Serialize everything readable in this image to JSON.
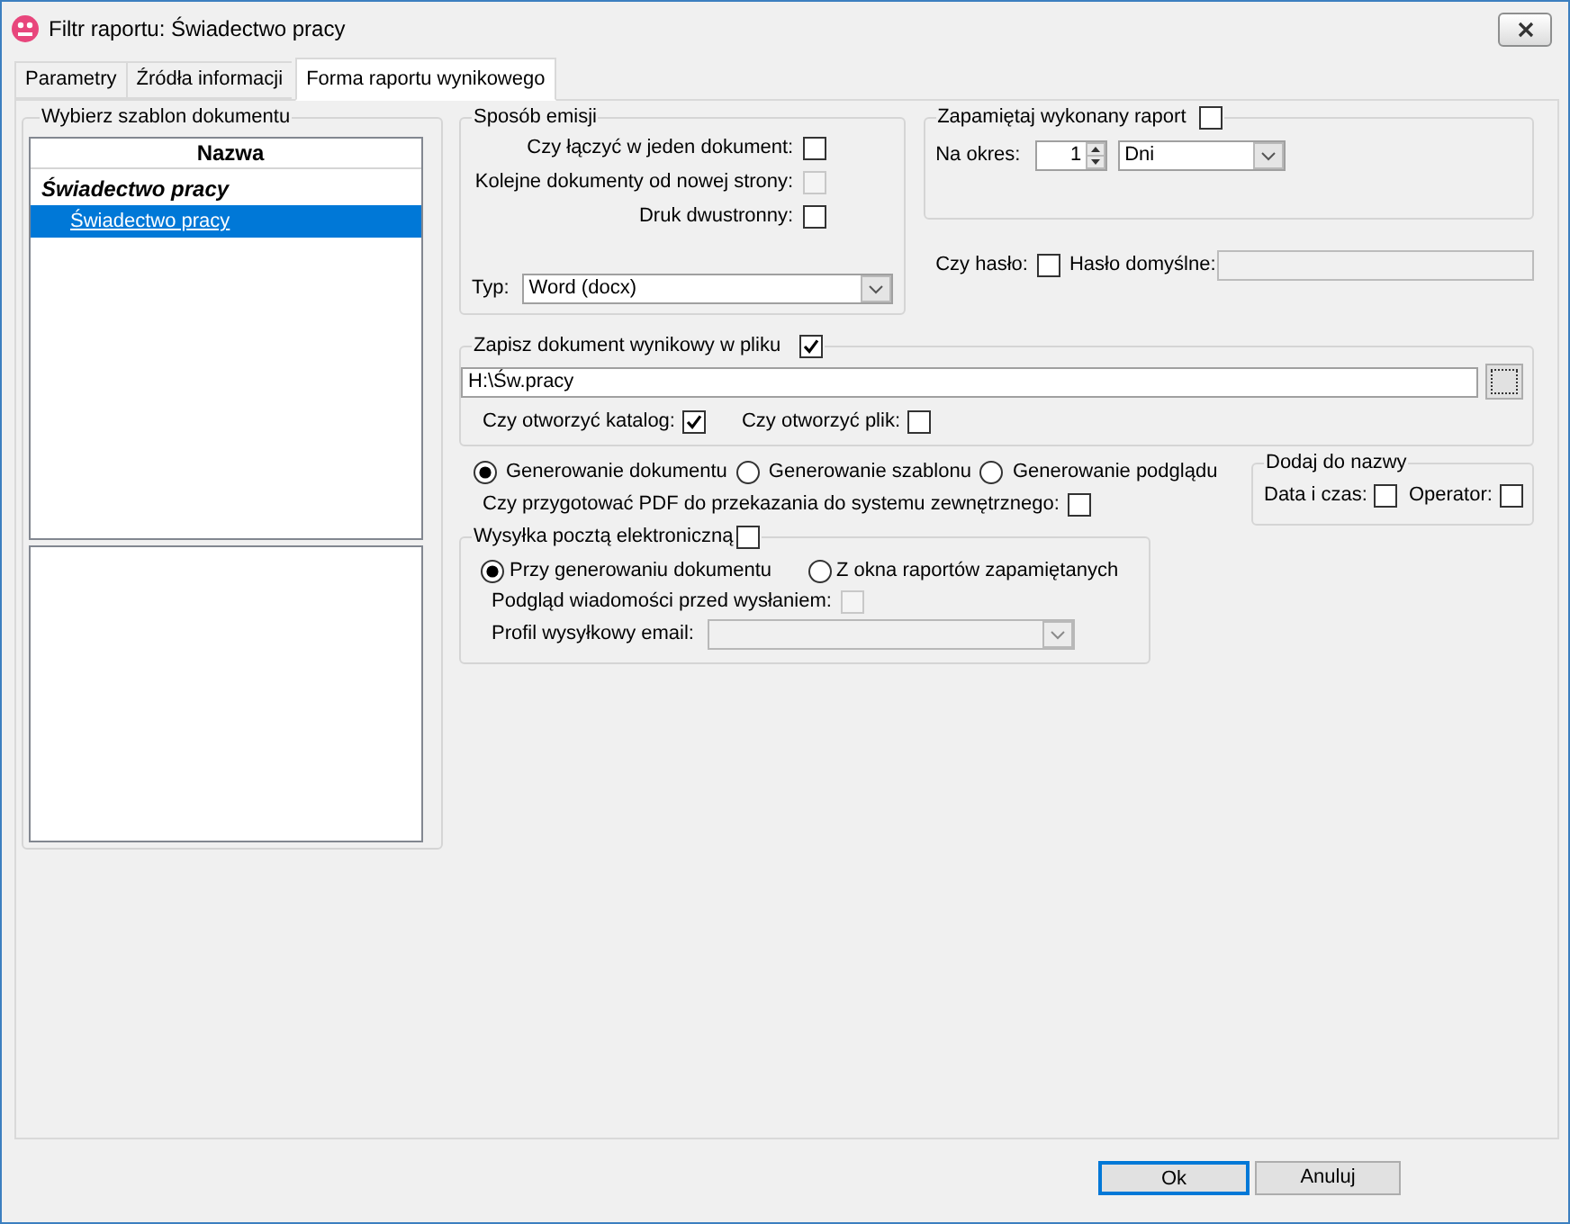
{
  "window": {
    "title": "Filtr raportu: Świadectwo pracy"
  },
  "tabs": [
    {
      "label": "Parametry",
      "selected": false
    },
    {
      "label": "Źródła informacji",
      "selected": false
    },
    {
      "label": "Forma raportu wynikowego",
      "selected": true
    }
  ],
  "template_list": {
    "title": "Wybierz szablon dokumentu",
    "column": "Nazwa",
    "items": [
      {
        "label": "Świadectwo pracy",
        "selected": false,
        "children": [
          {
            "label": "Świadectwo pracy",
            "selected": true
          }
        ]
      }
    ]
  },
  "emission": {
    "title": "Sposób emisji",
    "options": [
      {
        "label": "Czy łączyć w jeden dokument:",
        "checked": false,
        "disabled": false
      },
      {
        "label": "Kolejne dokumenty od nowej strony:",
        "checked": false,
        "disabled": true
      },
      {
        "label": "Druk dwustronny:",
        "checked": false,
        "disabled": false
      }
    ],
    "type": {
      "label": "Typ:",
      "value": "Word (docx)"
    }
  },
  "remember": {
    "title": "Zapamiętaj wykonany raport",
    "checked": false,
    "period_label": "Na okres:",
    "period_value": "1",
    "unit": "Dni"
  },
  "password": {
    "label": "Czy hasło:",
    "checked": false,
    "default_label": "Hasło domyślne:",
    "default_disabled": true
  },
  "save_file": {
    "title": "Zapisz dokument wynikowy w pliku",
    "checked": true,
    "path": "H:\\Św.pracy",
    "options": [
      {
        "label": "Czy otworzyć katalog:",
        "checked": true
      },
      {
        "label": "Czy otworzyć plik:",
        "checked": false
      }
    ]
  },
  "generation": [
    {
      "label": "Generowanie dokumentu",
      "selected": true
    },
    {
      "label": "Generowanie szablonu",
      "selected": false
    },
    {
      "label": "Generowanie podglądu",
      "selected": false
    }
  ],
  "pdf": {
    "label": "Czy przygotować PDF do przekazania do systemu zewnętrznego:",
    "checked": false
  },
  "add_to_name": {
    "title": "Dodaj do nazwy",
    "options": [
      {
        "label": "Data i czas:",
        "checked": false
      },
      {
        "label": "Operator:",
        "checked": false
      }
    ]
  },
  "email": {
    "title": "Wysyłka pocztą elektroniczną",
    "checked": false,
    "modes": [
      {
        "label": "Przy generowaniu dokumentu",
        "selected": true
      },
      {
        "label": "Z okna raportów zapamiętanych",
        "selected": false
      }
    ],
    "preview": {
      "label": "Podgląd wiadomości przed wysłaniem:",
      "checked": false,
      "disabled": true
    },
    "profile": {
      "label": "Profil wysyłkowy email:",
      "disabled": true
    }
  },
  "buttons": [
    {
      "label": "Ok",
      "default": true
    },
    {
      "label": "Anuluj",
      "default": false
    }
  ]
}
